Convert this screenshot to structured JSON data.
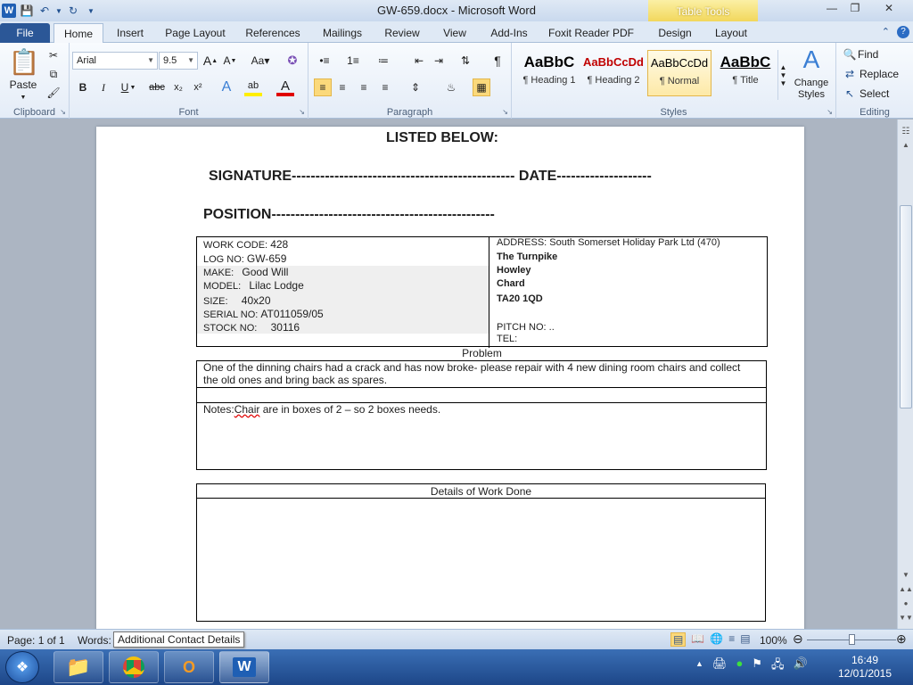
{
  "window": {
    "title": "GW-659.docx - Microsoft Word",
    "context_tab_group": "Table Tools"
  },
  "tabs": [
    "File",
    "Home",
    "Insert",
    "Page Layout",
    "References",
    "Mailings",
    "Review",
    "View",
    "Add-Ins",
    "Foxit Reader PDF",
    "Design",
    "Layout"
  ],
  "ribbon": {
    "clipboard": {
      "label": "Clipboard",
      "paste_label": "Paste"
    },
    "font": {
      "label": "Font",
      "font_name": "Arial",
      "font_size": "9.5",
      "bold": "B",
      "italic": "I",
      "underline": "U",
      "strike": "abc",
      "subscript": "x₂",
      "superscript": "x²"
    },
    "paragraph": {
      "label": "Paragraph"
    },
    "styles": {
      "label": "Styles",
      "items": [
        {
          "sample": "AaBbC",
          "name": "¶ Heading 1",
          "color": "#000000"
        },
        {
          "sample": "AaBbCcDd",
          "name": "¶ Heading 2",
          "color": "#c00000"
        },
        {
          "sample": "AaBbCcDd",
          "name": "¶ Normal",
          "color": "#000000"
        },
        {
          "sample": "AaBbC",
          "name": "¶ Title",
          "color": "#000000"
        }
      ],
      "change_styles": "Change Styles"
    },
    "editing": {
      "label": "Editing",
      "find": "Find",
      "replace": "Replace",
      "select": "Select"
    }
  },
  "document": {
    "listed_below": "LISTED BELOW:",
    "signature": "SIGNATURE----------------------------------------------- DATE--------------------",
    "position": "POSITION-----------------------------------------------",
    "job": {
      "work_code_label": "WORK CODE:",
      "work_code": "428",
      "log_no_label": "LOG NO:",
      "log_no": "GW-659",
      "make_label": "MAKE:",
      "make": "Good Will",
      "model_label": "MODEL:",
      "model": "Lilac Lodge",
      "size_label": "SIZE:",
      "size": "40x20",
      "serial_label": "SERIAL  NO:",
      "serial": "AT011059/05",
      "stock_label": "STOCK NO:",
      "stock": "30116"
    },
    "address": {
      "label_line": "ADDRESS:  South Somerset Holiday Park Ltd (470)",
      "line1": "The Turnpike",
      "line2": "Howley",
      "line3": "Chard",
      "line4": "TA20 1QD",
      "pitch": "PITCH NO:     ..",
      "tel": "TEL:"
    },
    "problem_header": "Problem",
    "problem_text": "  One of the dinning chairs had a crack and has now broke- please repair with 4 new dining room chairs and collect the old ones and bring back as spares.",
    "notes_prefix": "Notes:",
    "notes_word": "Chair",
    "notes_rest": " are in boxes of 2 – so 2 boxes needs.",
    "details_header": "Details of Work Done"
  },
  "status": {
    "page": "Page: 1 of 1",
    "words": "Words:",
    "tooltip": "Additional  Contact Details",
    "zoom": "100%"
  },
  "taskbar": {
    "time": "16:49",
    "date": "12/01/2015"
  }
}
